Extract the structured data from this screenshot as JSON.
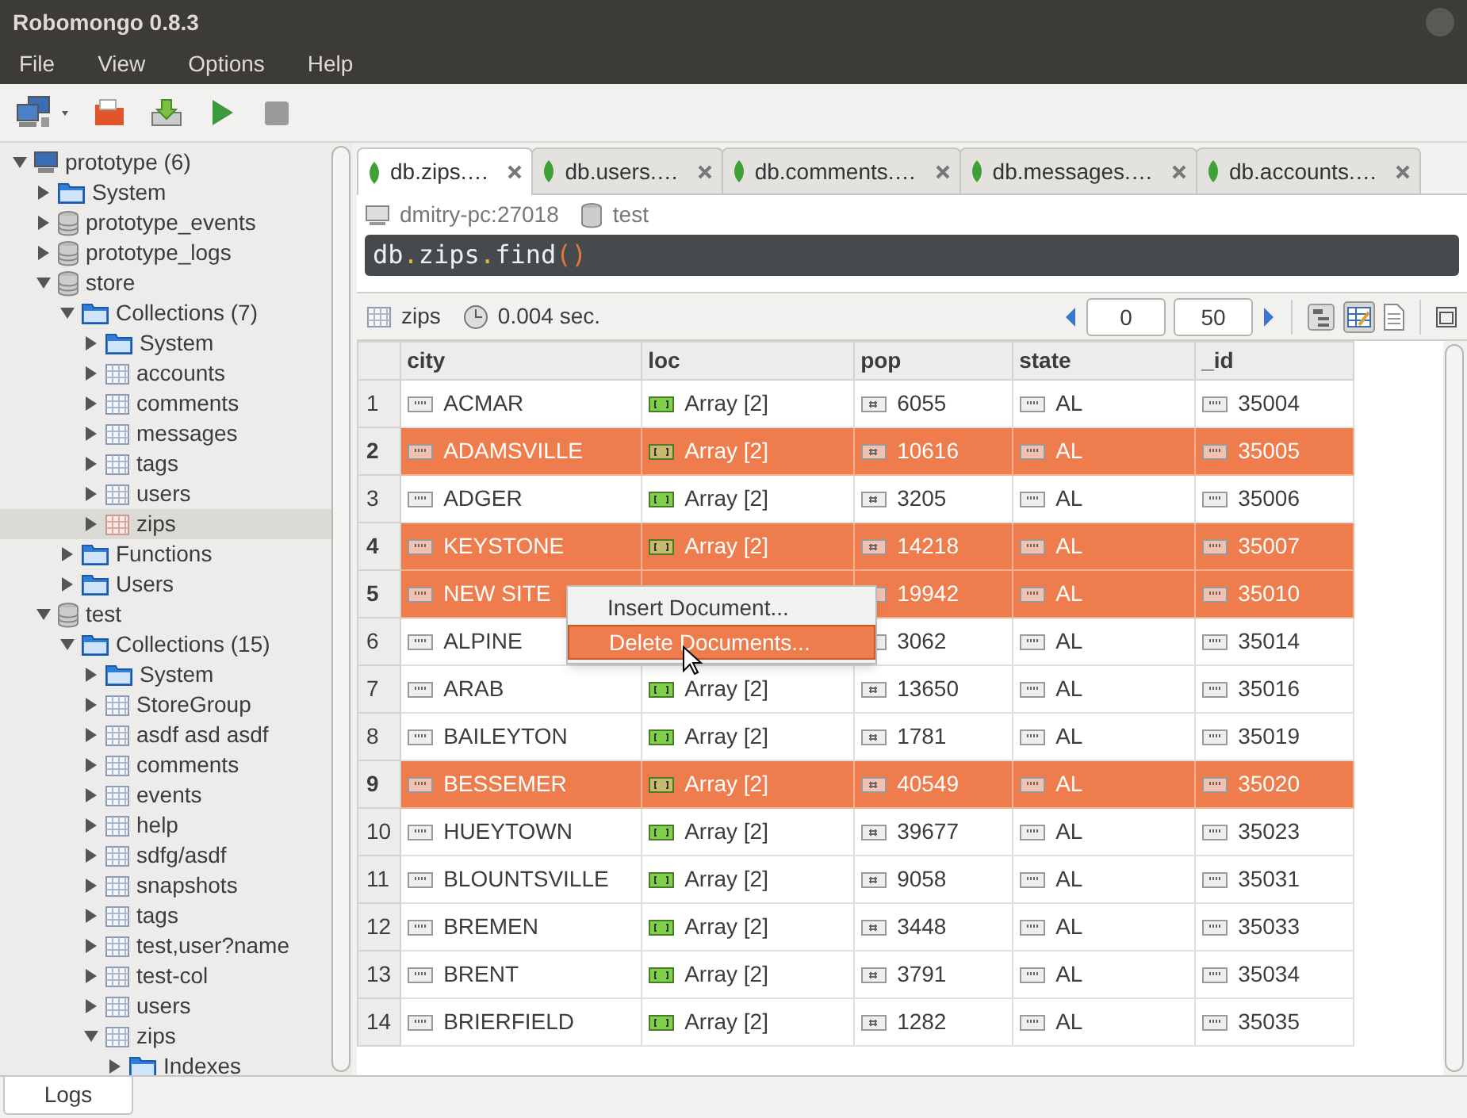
{
  "window": {
    "title": "Robomongo 0.8.3"
  },
  "menu": [
    "File",
    "View",
    "Options",
    "Help"
  ],
  "tree": [
    {
      "label": "prototype (6)",
      "kind": "server",
      "expanded": true,
      "selected": false,
      "children": [
        {
          "label": "System",
          "kind": "folder",
          "expanded": false,
          "selected": false
        },
        {
          "label": "prototype_events",
          "kind": "database",
          "expanded": false,
          "selected": false
        },
        {
          "label": "prototype_logs",
          "kind": "database",
          "expanded": false,
          "selected": false
        },
        {
          "label": "store",
          "kind": "database",
          "expanded": true,
          "selected": false,
          "children": [
            {
              "label": "Collections (7)",
              "kind": "folder",
              "expanded": true,
              "selected": false,
              "children": [
                {
                  "label": "System",
                  "kind": "folder",
                  "expanded": false,
                  "selected": false
                },
                {
                  "label": "accounts",
                  "kind": "collection",
                  "expanded": false,
                  "selected": false
                },
                {
                  "label": "comments",
                  "kind": "collection",
                  "expanded": false,
                  "selected": false
                },
                {
                  "label": "messages",
                  "kind": "collection",
                  "expanded": false,
                  "selected": false
                },
                {
                  "label": "tags",
                  "kind": "collection",
                  "expanded": false,
                  "selected": false
                },
                {
                  "label": "users",
                  "kind": "collection",
                  "expanded": false,
                  "selected": false
                },
                {
                  "label": "zips",
                  "kind": "collection",
                  "expanded": false,
                  "selected": true
                }
              ]
            },
            {
              "label": "Functions",
              "kind": "folder",
              "expanded": false,
              "selected": false
            },
            {
              "label": "Users",
              "kind": "folder",
              "expanded": false,
              "selected": false
            }
          ]
        },
        {
          "label": "test",
          "kind": "database",
          "expanded": true,
          "selected": false,
          "children": [
            {
              "label": "Collections (15)",
              "kind": "folder",
              "expanded": true,
              "selected": false,
              "children": [
                {
                  "label": "System",
                  "kind": "folder",
                  "expanded": false,
                  "selected": false
                },
                {
                  "label": "StoreGroup",
                  "kind": "collection",
                  "expanded": false,
                  "selected": false
                },
                {
                  "label": "asdf asd asdf",
                  "kind": "collection",
                  "expanded": false,
                  "selected": false
                },
                {
                  "label": "comments",
                  "kind": "collection",
                  "expanded": false,
                  "selected": false
                },
                {
                  "label": "events",
                  "kind": "collection",
                  "expanded": false,
                  "selected": false
                },
                {
                  "label": "help",
                  "kind": "collection",
                  "expanded": false,
                  "selected": false
                },
                {
                  "label": "sdfg/asdf",
                  "kind": "collection",
                  "expanded": false,
                  "selected": false
                },
                {
                  "label": "snapshots",
                  "kind": "collection",
                  "expanded": false,
                  "selected": false
                },
                {
                  "label": "tags",
                  "kind": "collection",
                  "expanded": false,
                  "selected": false
                },
                {
                  "label": "test,user?name",
                  "kind": "collection",
                  "expanded": false,
                  "selected": false
                },
                {
                  "label": "test-col",
                  "kind": "collection",
                  "expanded": false,
                  "selected": false
                },
                {
                  "label": "users",
                  "kind": "collection",
                  "expanded": false,
                  "selected": false
                },
                {
                  "label": "zips",
                  "kind": "collection",
                  "expanded": true,
                  "selected": false,
                  "children": [
                    {
                      "label": "Indexes",
                      "kind": "folder",
                      "expanded": false,
                      "selected": false
                    }
                  ]
                }
              ]
            }
          ]
        }
      ]
    }
  ],
  "tabs": [
    {
      "label": "db.zips.…",
      "selected": true
    },
    {
      "label": "db.users.…",
      "selected": false
    },
    {
      "label": "db.comments.…",
      "selected": false
    },
    {
      "label": "db.messages.…",
      "selected": false
    },
    {
      "label": "db.accounts.…",
      "selected": false
    }
  ],
  "connection": {
    "server": "dmitry-pc:27018",
    "database": "test"
  },
  "query": "db.zips.find()",
  "result": {
    "collection": "zips",
    "time": "0.004 sec.",
    "skip": "0",
    "limit": "50"
  },
  "table": {
    "columns": [
      {
        "label": "city",
        "kind": "string"
      },
      {
        "label": "loc",
        "kind": "array"
      },
      {
        "label": "pop",
        "kind": "number"
      },
      {
        "label": "state",
        "kind": "string"
      },
      {
        "label": "_id",
        "kind": "string"
      }
    ],
    "rows": [
      {
        "n": "1",
        "selected": false,
        "cells": [
          "ACMAR",
          "Array [2]",
          "6055",
          "AL",
          "35004"
        ]
      },
      {
        "n": "2",
        "selected": true,
        "cells": [
          "ADAMSVILLE",
          "Array [2]",
          "10616",
          "AL",
          "35005"
        ]
      },
      {
        "n": "3",
        "selected": false,
        "cells": [
          "ADGER",
          "Array [2]",
          "3205",
          "AL",
          "35006"
        ]
      },
      {
        "n": "4",
        "selected": true,
        "cells": [
          "KEYSTONE",
          "Array [2]",
          "14218",
          "AL",
          "35007"
        ]
      },
      {
        "n": "5",
        "selected": true,
        "cells": [
          "NEW SITE",
          "",
          "19942",
          "AL",
          "35010"
        ]
      },
      {
        "n": "6",
        "selected": false,
        "cells": [
          "ALPINE",
          "",
          "3062",
          "AL",
          "35014"
        ]
      },
      {
        "n": "7",
        "selected": false,
        "cells": [
          "ARAB",
          "Array [2]",
          "13650",
          "AL",
          "35016"
        ]
      },
      {
        "n": "8",
        "selected": false,
        "cells": [
          "BAILEYTON",
          "Array [2]",
          "1781",
          "AL",
          "35019"
        ]
      },
      {
        "n": "9",
        "selected": true,
        "cells": [
          "BESSEMER",
          "Array [2]",
          "40549",
          "AL",
          "35020"
        ]
      },
      {
        "n": "10",
        "selected": false,
        "cells": [
          "HUEYTOWN",
          "Array [2]",
          "39677",
          "AL",
          "35023"
        ]
      },
      {
        "n": "11",
        "selected": false,
        "cells": [
          "BLOUNTSVILLE",
          "Array [2]",
          "9058",
          "AL",
          "35031"
        ]
      },
      {
        "n": "12",
        "selected": false,
        "cells": [
          "BREMEN",
          "Array [2]",
          "3448",
          "AL",
          "35033"
        ]
      },
      {
        "n": "13",
        "selected": false,
        "cells": [
          "BRENT",
          "Array [2]",
          "3791",
          "AL",
          "35034"
        ]
      },
      {
        "n": "14",
        "selected": false,
        "cells": [
          "BRIERFIELD",
          "Array [2]",
          "1282",
          "AL",
          "35035"
        ]
      }
    ]
  },
  "context_menu": [
    {
      "label": "Insert Document...",
      "selected": false
    },
    {
      "label": "Delete Documents...",
      "selected": true
    }
  ],
  "bottom_tabs": [
    "Logs"
  ]
}
